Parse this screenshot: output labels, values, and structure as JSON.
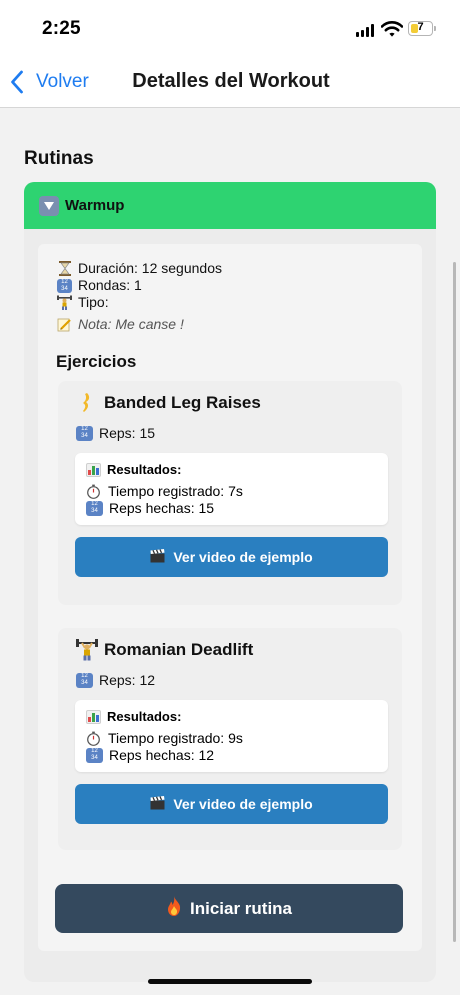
{
  "status_bar": {
    "time": "2:25",
    "battery": "7"
  },
  "nav": {
    "back_label": "Volver",
    "title": "Detalles del Workout"
  },
  "section_title": "Rutinas",
  "routine": {
    "name": "Warmup",
    "details": {
      "duration": "Duración: 12 segundos",
      "rounds": "Rondas: 1",
      "type": "Tipo:",
      "note": "Nota: Me canse !"
    },
    "exercises_title": "Ejercicios",
    "exercises": [
      {
        "name": "Banded Leg Raises",
        "reps": "Reps: 15",
        "results_title": "Resultados:",
        "time_recorded": "Tiempo registrado: 7s",
        "reps_done": "Reps hechas: 15",
        "video_button": "Ver video de ejemplo"
      },
      {
        "name": "Romanian Deadlift",
        "reps": "Reps: 12",
        "results_title": "Resultados:",
        "time_recorded": "Tiempo registrado: 9s",
        "reps_done": "Reps hechas: 12",
        "video_button": "Ver video de ejemplo"
      }
    ],
    "start_button": "Iniciar rutina"
  },
  "colors": {
    "routine_header": "#2ed371",
    "video_button": "#2a7fc0",
    "start_button": "#34495e",
    "back_link": "#1e7cf0"
  }
}
